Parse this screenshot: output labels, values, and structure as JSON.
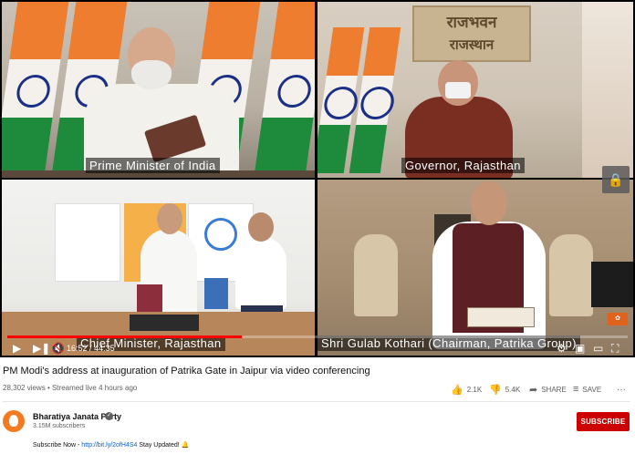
{
  "player": {
    "captions": {
      "top_left": "Prime Minister of India",
      "top_right": "Governor, Rajasthan",
      "bottom_left": "Chief Minister, Rajasthan",
      "bottom_right": "Shri Gulab Kothari (Chairman, Patrika Group)"
    },
    "sign_text": {
      "line1": "राजभवन",
      "line2": "राजस्थान"
    },
    "time_current": "16:52",
    "time_total": "44:35",
    "progress": 0.378,
    "icons": {
      "play": "play-icon",
      "next": "next-icon",
      "volume": "volume-muted-icon",
      "settings": "gear-icon",
      "miniplayer": "miniplayer-icon",
      "theater": "theater-icon",
      "fullscreen": "fullscreen-icon",
      "lock": "lock-icon"
    },
    "accent_color": "#ff0000"
  },
  "video": {
    "title": "PM Modi's address at inauguration of Patrika Gate in Jaipur via video conferencing",
    "views": "28,302 views",
    "streamed": "Streamed live 4 hours ago",
    "likes": "2.1K",
    "dislikes": "5.4K",
    "share_label": "SHARE",
    "save_label": "SAVE",
    "more_label": "···"
  },
  "channel": {
    "name": "Bharatiya Janata Party",
    "subscribers": "3.15M subscribers",
    "subscribe_label": "SUBSCRIBE",
    "subscribe_color": "#cc0000"
  },
  "description": {
    "prefix": "Subscribe Now - ",
    "link": "http://bit.ly/2ofH4S4",
    "suffix": " Stay Updated! ",
    "emoji": "🔔"
  }
}
